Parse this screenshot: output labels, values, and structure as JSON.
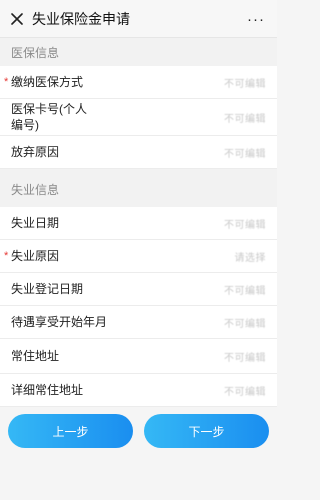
{
  "nav": {
    "title": "失业保险金申请",
    "more": "···"
  },
  "sections": {
    "medical": {
      "title": "医保信息",
      "rows": [
        {
          "label": "缴纳医保方式",
          "value": "不可编辑",
          "required": "*"
        },
        {
          "label": "医保卡号(个人编号)",
          "value": "不可编辑"
        },
        {
          "label": "放弃原因",
          "value": "不可编辑"
        }
      ]
    },
    "unemployment": {
      "title": "失业信息",
      "rows": [
        {
          "label": "失业日期",
          "value": "不可编辑"
        },
        {
          "label": "失业原因",
          "value": "请选择",
          "required": "*"
        },
        {
          "label": "失业登记日期",
          "value": "不可编辑"
        },
        {
          "label": "待遇享受开始年月",
          "value": "不可编辑"
        },
        {
          "label": "常住地址",
          "value": "不可编辑"
        },
        {
          "label": "详细常住地址",
          "value": "不可编辑"
        }
      ]
    }
  },
  "buttons": {
    "prev": "上一步",
    "next": "下一步"
  },
  "colors": {
    "button_gradient_start": "#35b8f5",
    "button_gradient_end": "#1a8ef0",
    "required": "#e53935"
  }
}
